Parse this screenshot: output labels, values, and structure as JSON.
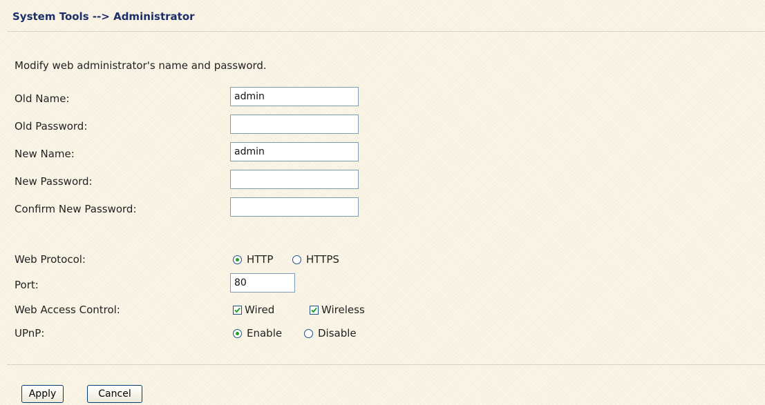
{
  "header": {
    "title": "System Tools --> Administrator"
  },
  "form": {
    "description": "Modify web administrator's name and password.",
    "old_name": {
      "label": "Old Name:",
      "value": "admin"
    },
    "old_password": {
      "label": "Old Password:",
      "value": ""
    },
    "new_name": {
      "label": "New Name:",
      "value": "admin"
    },
    "new_password": {
      "label": "New Password:",
      "value": ""
    },
    "confirm_password": {
      "label": "Confirm New Password:",
      "value": ""
    },
    "web_protocol": {
      "label": "Web Protocol:",
      "options": [
        "HTTP",
        "HTTPS"
      ],
      "selected": "HTTP"
    },
    "port": {
      "label": "Port:",
      "value": "80"
    },
    "web_access_control": {
      "label": "Web Access Control:",
      "options": [
        {
          "label": "Wired",
          "checked": true
        },
        {
          "label": "Wireless",
          "checked": true
        }
      ]
    },
    "upnp": {
      "label": "UPnP:",
      "options": [
        "Enable",
        "Disable"
      ],
      "selected": "Enable"
    }
  },
  "buttons": {
    "apply_label": "Apply",
    "cancel_label": "Cancel"
  },
  "colors": {
    "background": "#faf5e6",
    "title": "#1c2f6a",
    "radio_selected": "#21a121",
    "input_border": "#7f9db9"
  }
}
